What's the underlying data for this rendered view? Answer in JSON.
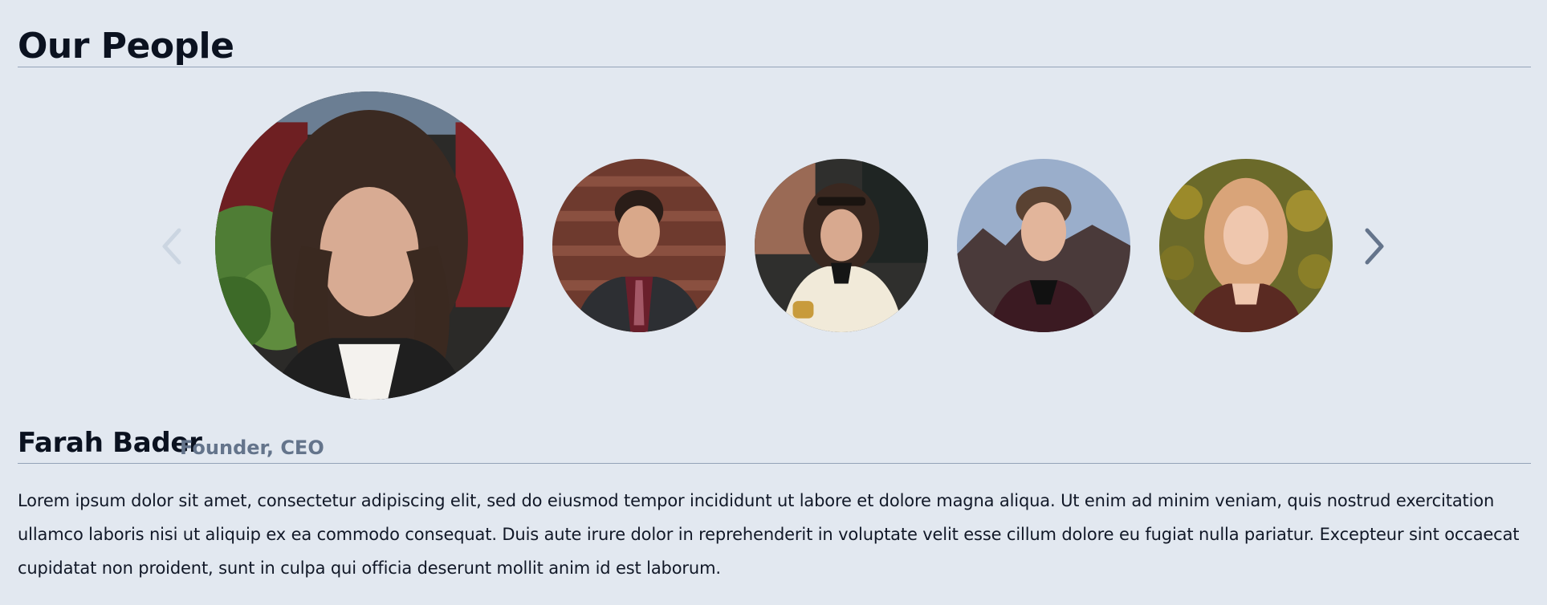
{
  "section": {
    "title": "Our People"
  },
  "carousel": {
    "prev_icon": "chevron-left-icon",
    "next_icon": "chevron-right-icon",
    "people": [
      {
        "name": "Farah Bader",
        "role": "Founder, CEO",
        "selected": true
      },
      {
        "name": "",
        "role": "",
        "selected": false
      },
      {
        "name": "",
        "role": "",
        "selected": false
      },
      {
        "name": "",
        "role": "",
        "selected": false
      },
      {
        "name": "",
        "role": "",
        "selected": false
      }
    ]
  },
  "profile": {
    "name": "Farah Bader",
    "role": "Founder, CEO",
    "bio": "Lorem ipsum dolor sit amet, consectetur adipiscing elit, sed do eiusmod tempor incididunt ut labore et dolore magna aliqua. Ut enim ad minim veniam, quis nostrud exercitation ullamco laboris nisi ut aliquip ex ea commodo consequat. Duis aute irure dolor in reprehenderit in voluptate velit esse cillum dolore eu fugiat nulla pariatur. Excepteur sint occaecat cupidatat non proident, sunt in culpa qui officia deserunt mollit anim id est laborum."
  },
  "colors": {
    "background": "#e2e8f0",
    "rule": "#94a3b8",
    "arrow_disabled": "#cbd5e1",
    "arrow_active": "#64748b",
    "role_text": "#64748b"
  }
}
